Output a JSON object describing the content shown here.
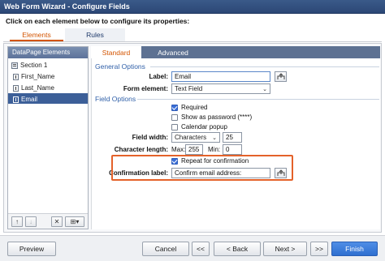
{
  "window": {
    "title": "Web Form Wizard - Configure Fields"
  },
  "instruction": "Click on each element below to configure its properties:",
  "top_tabs": [
    {
      "label": "Elements",
      "active": true
    },
    {
      "label": "Rules",
      "active": false
    }
  ],
  "left_pane": {
    "header": "DataPage Elements",
    "items": [
      {
        "label": "Section 1",
        "icon": "section-icon",
        "selected": false
      },
      {
        "label": "First_Name",
        "icon": "field-icon",
        "selected": false
      },
      {
        "label": "Last_Name",
        "icon": "field-icon",
        "selected": false
      },
      {
        "label": "Email",
        "icon": "field-icon",
        "selected": true
      }
    ],
    "toolbar": {
      "up": "↑",
      "down": "↓",
      "delete": "✕",
      "insert": "⊞▾"
    }
  },
  "right_tabs": [
    {
      "label": "Standard",
      "active": true
    },
    {
      "label": "Advanced",
      "active": false
    }
  ],
  "general_options": {
    "title": "General Options",
    "label_label": "Label:",
    "label_value": "Email",
    "form_element_label": "Form element:",
    "form_element_value": "Text Field"
  },
  "field_options": {
    "title": "Field Options",
    "required": {
      "label": "Required",
      "checked": true
    },
    "show_password": {
      "label": "Show as password (****)",
      "checked": false
    },
    "calendar_popup": {
      "label": "Calendar popup",
      "checked": false
    },
    "field_width_label": "Field width:",
    "field_width_unit": "Characters",
    "field_width_value": "25",
    "char_length_label": "Character length:",
    "max_label": "Max:",
    "max_value": "255",
    "min_label": "Min:",
    "min_value": "0",
    "repeat": {
      "label": "Repeat for confirmation",
      "checked": true
    },
    "confirmation_label_label": "Confirmation label:",
    "confirmation_label_value": "Confirm email address:"
  },
  "footer": {
    "preview": "Preview",
    "cancel": "Cancel",
    "first": "<<",
    "back": "< Back",
    "next": "Next >",
    "last": ">>",
    "finish": "Finish"
  },
  "colors": {
    "accent": "#d35400",
    "titlebar": "#2c4776",
    "selection": "#3c5f98",
    "highlight_border": "#e4622a",
    "primary_button": "#2f6fd0"
  }
}
